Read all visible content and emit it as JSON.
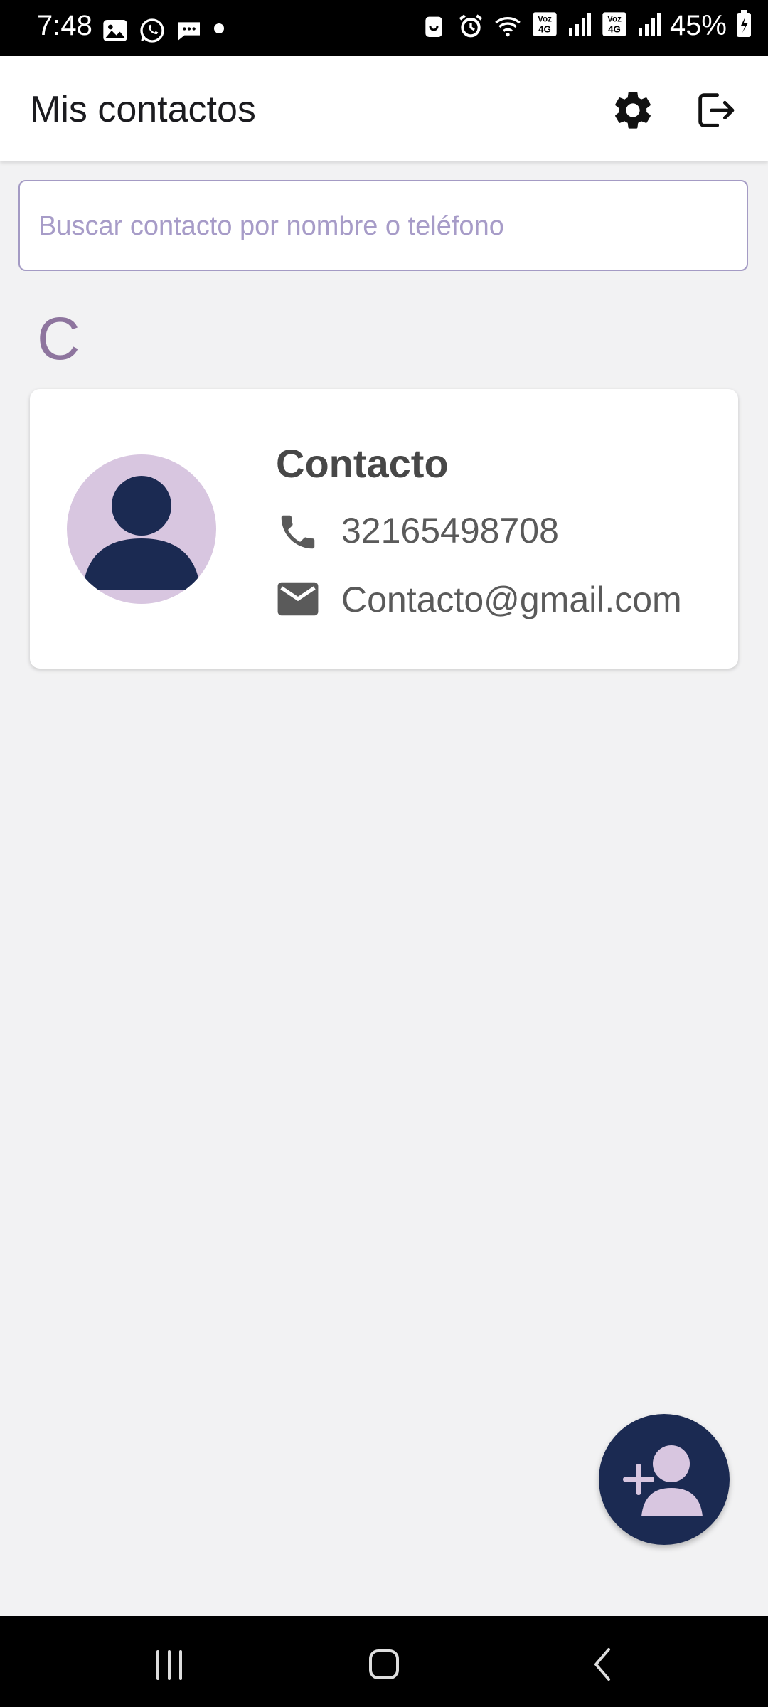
{
  "status_bar": {
    "time": "7:48",
    "battery": "45%",
    "left_icons": [
      "gallery-icon",
      "whatsapp-icon",
      "messages-icon",
      "dot-icon"
    ],
    "right_icons": [
      "battery-saver-icon",
      "alarm-icon",
      "wifi-icon",
      "volte-4g-1-icon",
      "signal-1-icon",
      "volte-4g-2-icon",
      "signal-2-icon",
      "battery-icon"
    ]
  },
  "app_bar": {
    "title": "Mis contactos",
    "settings_icon": "gear-icon",
    "logout_icon": "logout-icon"
  },
  "search": {
    "placeholder": "Buscar contacto por nombre o teléfono",
    "value": ""
  },
  "sections": [
    {
      "letter": "C",
      "contacts": [
        {
          "name": "Contacto",
          "phone": "32165498708",
          "email": "Contacto@gmail.com",
          "avatar_icon": "person-avatar-icon"
        }
      ]
    }
  ],
  "fab": {
    "icon": "add-person-icon"
  },
  "colors": {
    "accent_dark": "#1b2a52",
    "avatar_bg": "#d8c6e0",
    "section_letter": "#8e759e",
    "search_border": "#a49bc4",
    "background": "#f2f2f3"
  },
  "nav_bar": {
    "buttons": [
      "recents-icon",
      "home-icon",
      "back-icon"
    ]
  }
}
